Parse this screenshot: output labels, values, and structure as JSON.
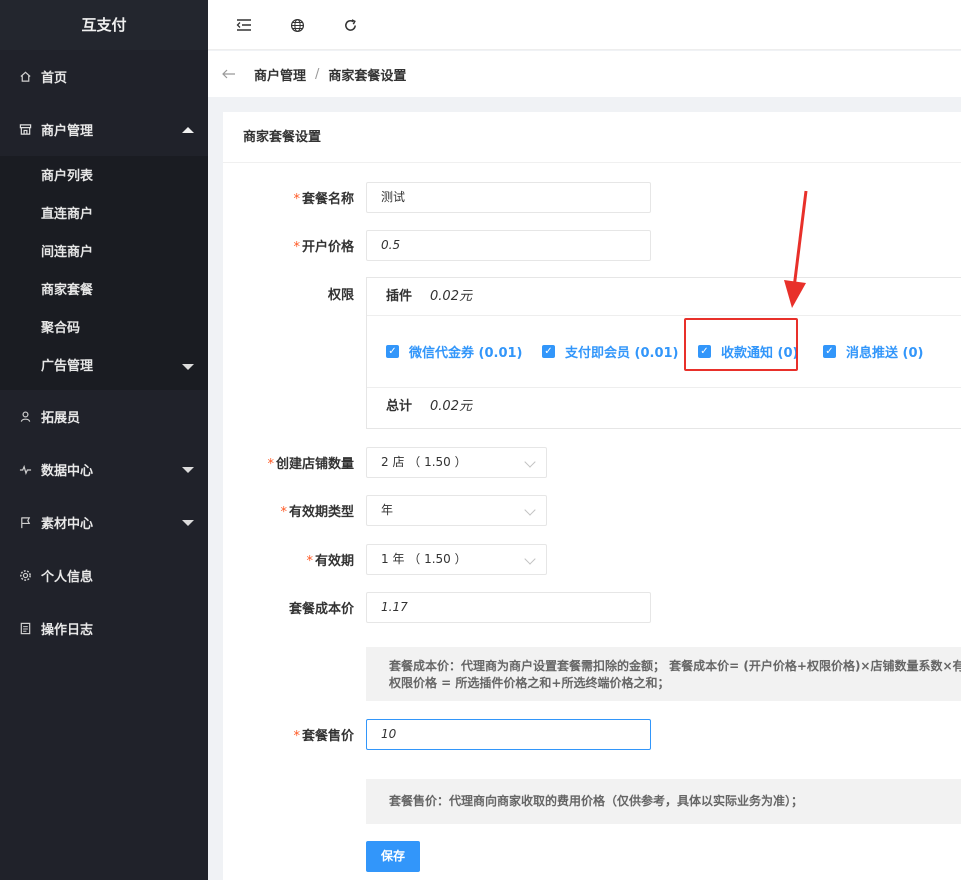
{
  "app": {
    "title": "互支付"
  },
  "sidebar": {
    "items": [
      {
        "label": "首页",
        "icon": "home-icon"
      },
      {
        "label": "商户管理",
        "icon": "store-icon",
        "expanded": true
      },
      {
        "label": "拓展员",
        "icon": "user-icon"
      },
      {
        "label": "数据中心",
        "icon": "pulse-icon"
      },
      {
        "label": "素材中心",
        "icon": "flag-icon"
      },
      {
        "label": "个人信息",
        "icon": "gear-icon"
      },
      {
        "label": "操作日志",
        "icon": "log-icon"
      }
    ],
    "submenu": [
      {
        "label": "商户列表"
      },
      {
        "label": "直连商户"
      },
      {
        "label": "间连商户"
      },
      {
        "label": "商家套餐"
      },
      {
        "label": "聚合码"
      },
      {
        "label": "广告管理"
      }
    ]
  },
  "topbar": {
    "icons": [
      "menu-collapse-icon",
      "globe-icon",
      "refresh-icon"
    ]
  },
  "breadcrumb": {
    "parent": "商户管理",
    "separator": "/",
    "current": "商家套餐设置"
  },
  "card": {
    "title": "商家套餐设置"
  },
  "form": {
    "required_mark": "*",
    "package_name": {
      "label": "套餐名称",
      "value": "测试"
    },
    "open_price": {
      "label": "开户价格",
      "value": "0.5"
    },
    "permissions": {
      "label": "权限",
      "plugin_label": "插件",
      "plugin_price": "0.02元",
      "options": [
        {
          "label": "微信代金券 (0.01)",
          "checked": true
        },
        {
          "label": "支付即会员 (0.01)",
          "checked": true
        },
        {
          "label": "收款通知 (0)",
          "checked": true
        },
        {
          "label": "消息推送 (0)",
          "checked": true
        }
      ],
      "total_label": "总计",
      "total_price": "0.02元"
    },
    "store_count": {
      "label": "创建店铺数量",
      "value": "2 店 （ 1.50 ）"
    },
    "validity_type": {
      "label": "有效期类型",
      "value": "年"
    },
    "validity": {
      "label": "有效期",
      "value": "1 年 （ 1.50 ）"
    },
    "cost_price": {
      "label": "套餐成本价",
      "value": "1.17"
    },
    "cost_tip_line1": "套餐成本价：代理商为商户设置套餐需扣除的金额； 套餐成本价= (开户价格+权限价格)×店铺数量系数×有",
    "cost_tip_line2": "权限价格 = 所选插件价格之和+所选终端价格之和；",
    "sale_price": {
      "label": "套餐售价",
      "value": "10"
    },
    "sale_tip": "套餐售价：代理商向商家收取的费用价格（仅供参考，具体以实际业务为准）；",
    "save_label": "保存"
  },
  "colors": {
    "accent": "#3296fa",
    "sidebar_bg": "#20222a",
    "annotation": "#e8302a",
    "required": "#ff5722"
  }
}
